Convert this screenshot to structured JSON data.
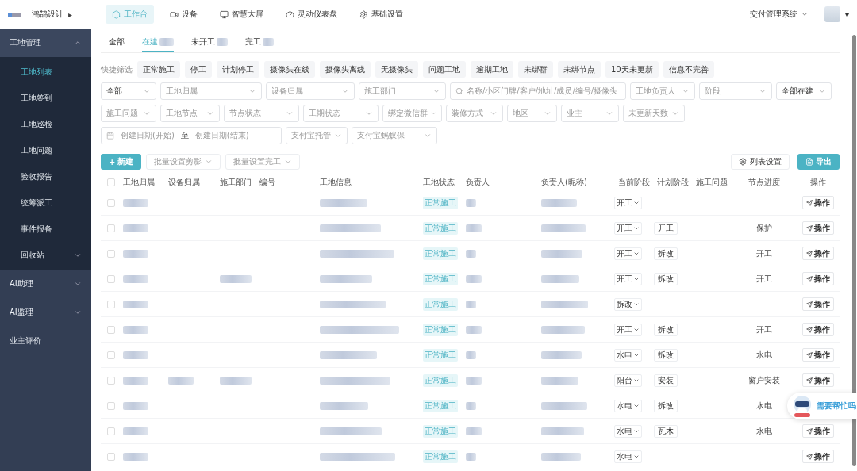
{
  "topbar": {
    "brand": "鸿鹄设计",
    "brand_caret": "▸",
    "nav": [
      {
        "label": "工作台",
        "selected": true
      },
      {
        "label": "设备",
        "selected": false
      },
      {
        "label": "智慧大屏",
        "selected": false
      },
      {
        "label": "灵动仪表盘",
        "selected": false
      },
      {
        "label": "基础设置",
        "selected": false
      }
    ],
    "system": "交付管理系统",
    "avatar_caret": "▾"
  },
  "sidebar": {
    "items": [
      {
        "label": "工地管理",
        "expanded": true,
        "expandable": true,
        "children": [
          {
            "label": "工地列表",
            "selected": true,
            "expandable": false
          },
          {
            "label": "工地签到",
            "selected": false,
            "expandable": false
          },
          {
            "label": "工地巡检",
            "selected": false,
            "expandable": false
          },
          {
            "label": "工地问题",
            "selected": false,
            "expandable": false
          },
          {
            "label": "验收报告",
            "selected": false,
            "expandable": false
          },
          {
            "label": "统筹派工",
            "selected": false,
            "expandable": false
          },
          {
            "label": "事件报备",
            "selected": false,
            "expandable": false
          },
          {
            "label": "回收站",
            "selected": false,
            "expandable": true
          }
        ]
      },
      {
        "label": "AI助理",
        "expanded": false,
        "expandable": true
      },
      {
        "label": "AI监理",
        "expanded": false,
        "expandable": true
      },
      {
        "label": "业主评价",
        "expandable": false
      }
    ]
  },
  "status_tabs": [
    {
      "label": "全部",
      "selected": false,
      "blurred_count": false
    },
    {
      "label": "在建",
      "selected": true,
      "blurred_count": true
    },
    {
      "label": "未开工",
      "selected": false,
      "blurred_count": true
    },
    {
      "label": "完工",
      "selected": false,
      "blurred_count": true
    }
  ],
  "quick_filter": {
    "label": "快捷筛选",
    "chips": [
      "正常施工",
      "停工",
      "计划停工",
      "摄像头在线",
      "摄像头离线",
      "无摄像头",
      "问题工地",
      "逾期工地",
      "未绑群",
      "未绑节点",
      "10天未更新",
      "信息不完善"
    ]
  },
  "filter_rows": [
    [
      {
        "kind": "select",
        "value": "全部"
      },
      {
        "kind": "select",
        "placeholder": "工地归属"
      },
      {
        "kind": "select",
        "placeholder": "设备归属"
      },
      {
        "kind": "select",
        "placeholder": "施工部门"
      },
      {
        "kind": "search",
        "placeholder": "名称/小区门牌/客户/地址/成员/编号/摄像头"
      },
      {
        "kind": "select",
        "placeholder": "工地负责人"
      },
      {
        "kind": "select",
        "placeholder": "阶段"
      },
      {
        "kind": "select",
        "value": "全部在建"
      }
    ],
    [
      {
        "kind": "select",
        "placeholder": "施工问题"
      },
      {
        "kind": "select",
        "placeholder": "工地节点"
      },
      {
        "kind": "select",
        "placeholder": "节点状态"
      },
      {
        "kind": "select",
        "placeholder": "工期状态"
      },
      {
        "kind": "select",
        "placeholder": "绑定微信群"
      },
      {
        "kind": "select",
        "placeholder": "装修方式"
      },
      {
        "kind": "select",
        "placeholder": "地区"
      },
      {
        "kind": "select",
        "placeholder": "业主"
      },
      {
        "kind": "select",
        "placeholder": "未更新天数"
      }
    ],
    [
      {
        "kind": "daterange",
        "placeholder": "创建日期(开始)",
        "separator": "至",
        "placeholder_end": "创建日期(结束)"
      },
      {
        "kind": "select",
        "placeholder": "支付宝托管"
      },
      {
        "kind": "select",
        "placeholder": "支付宝蚂蚁保"
      }
    ]
  ],
  "actions": {
    "create": "新建",
    "create_icon": "+",
    "batch": [
      "批量设置剪影",
      "批量设置完工"
    ],
    "list_settings": "列表设置",
    "export": "导出"
  },
  "table": {
    "all_checked": false,
    "columns": [
      "工地归属",
      "设备归属",
      "施工部门",
      "编号",
      "工地信息",
      "工地状态",
      "负责人",
      "负责人(昵称)",
      "当前阶段",
      "计划阶段",
      "施工问题",
      "节点进度",
      "操作"
    ],
    "rows": [
      {
        "checked": false,
        "site": true,
        "device": false,
        "dept": false,
        "info": true,
        "status": "正常施工",
        "person": true,
        "nickname": true,
        "stage": "开工",
        "action": "操作"
      },
      {
        "checked": false,
        "site": true,
        "device": false,
        "dept": false,
        "info": true,
        "status": "正常施工",
        "person": true,
        "nickname": true,
        "stage": "开工",
        "plan": "开工",
        "node": "保护",
        "action": "操作"
      },
      {
        "checked": false,
        "site": true,
        "device": false,
        "dept": false,
        "info": true,
        "status": "正常施工",
        "person": true,
        "nickname": true,
        "stage": "开工",
        "plan": "拆改",
        "node": "开工",
        "action": "操作"
      },
      {
        "checked": false,
        "site": true,
        "device": false,
        "dept": true,
        "info": true,
        "status": "正常施工",
        "person": true,
        "nickname": true,
        "stage": "开工",
        "plan": "拆改",
        "node": "开工",
        "action": "操作"
      },
      {
        "checked": false,
        "site": true,
        "device": false,
        "dept": false,
        "info": true,
        "status": "正常施工",
        "person": true,
        "nickname": true,
        "stage": "拆改",
        "action": "操作"
      },
      {
        "checked": false,
        "site": true,
        "device": false,
        "dept": false,
        "info": true,
        "status": "正常施工",
        "person": true,
        "nickname": true,
        "stage": "开工",
        "plan": "拆改",
        "node": "开工",
        "action": "操作"
      },
      {
        "checked": false,
        "site": true,
        "device": false,
        "dept": false,
        "info": true,
        "status": "正常施工",
        "person": true,
        "nickname": true,
        "stage": "水电",
        "plan": "拆改",
        "node": "水电",
        "action": "操作"
      },
      {
        "checked": false,
        "site": true,
        "device": true,
        "dept": true,
        "info": true,
        "status": "正常施工",
        "person": true,
        "nickname": true,
        "stage": "阳台",
        "plan": "安装",
        "node": "窗户安装",
        "action": "操作"
      },
      {
        "checked": false,
        "site": true,
        "device": false,
        "dept": false,
        "info": true,
        "status": "正常施工",
        "person": true,
        "nickname": true,
        "stage": "水电",
        "plan": "拆改",
        "node": "水电"
      },
      {
        "checked": false,
        "site": true,
        "device": false,
        "dept": false,
        "info": true,
        "status": "正常施工",
        "person": true,
        "nickname": true,
        "stage": "水电",
        "plan": "瓦木",
        "node": "水电",
        "action": "操作"
      },
      {
        "checked": false,
        "site": true,
        "device": false,
        "dept": false,
        "info": true,
        "status": "正常施工",
        "person": true,
        "nickname": true,
        "stage": "水电",
        "action": "操作"
      }
    ]
  },
  "help_widget": {
    "label": "需要帮忙吗"
  }
}
